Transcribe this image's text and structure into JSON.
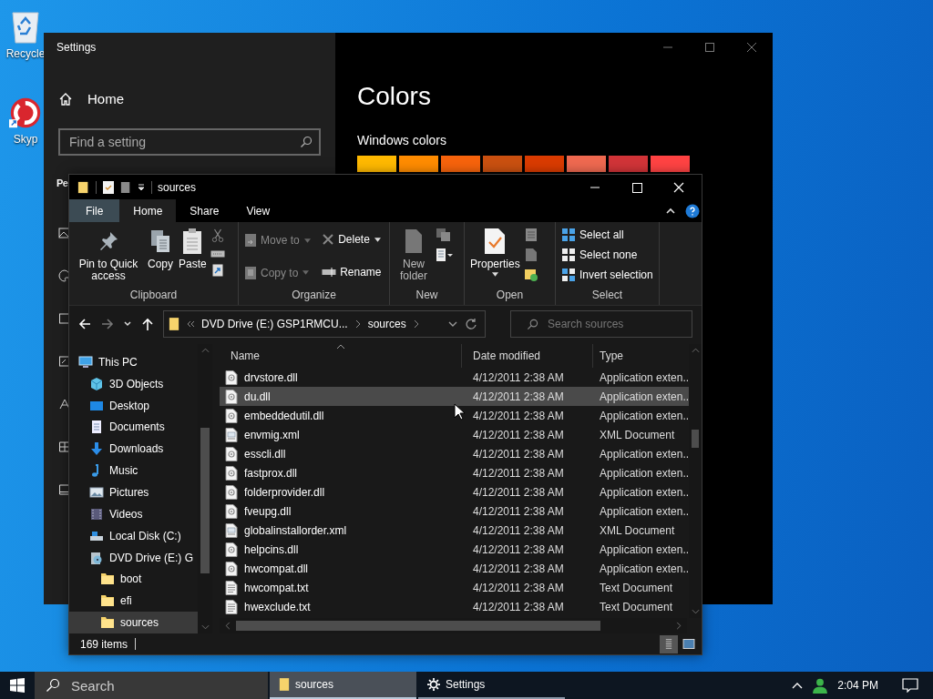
{
  "desktop": {
    "icons": [
      {
        "kind": "recycle",
        "label": "Recycle"
      },
      {
        "kind": "skype",
        "label": "Skyp"
      }
    ]
  },
  "settings": {
    "title": "Settings",
    "home": "Home",
    "search": {
      "placeholder": "Find a setting"
    },
    "section": "Pe",
    "nav_icons": [
      {
        "kind": "picture"
      },
      {
        "kind": "palette"
      },
      {
        "kind": "square"
      },
      {
        "kind": "tablet"
      },
      {
        "kind": "font"
      },
      {
        "kind": "start"
      },
      {
        "kind": "taskbar"
      }
    ],
    "page_title": "Colors",
    "subheading": "Windows colors",
    "swatches": [
      {
        "color": "#ffb900"
      },
      {
        "color": "#ff8c00"
      },
      {
        "color": "#f7630c"
      },
      {
        "color": "#ca5010"
      },
      {
        "color": "#da3b01"
      },
      {
        "color": "#ef6950"
      },
      {
        "color": "#d13438"
      },
      {
        "color": "#ff4343"
      }
    ]
  },
  "explorer": {
    "title": "sources",
    "tabs": [
      {
        "label": "File",
        "kind": "file",
        "selected": false
      },
      {
        "label": "Home",
        "kind": "tab",
        "selected": true
      },
      {
        "label": "Share",
        "kind": "tab",
        "selected": false
      },
      {
        "label": "View",
        "kind": "tab",
        "selected": false
      }
    ],
    "clipboard": {
      "label": "Clipboard",
      "buttons": [
        {
          "label": "Pin to Quick access",
          "kind": "pin"
        },
        {
          "label": "Copy",
          "kind": "copy"
        },
        {
          "label": "Paste",
          "kind": "paste"
        }
      ]
    },
    "organize": {
      "label": "Organize",
      "buttons": [
        {
          "label": "Move to",
          "kind": "move",
          "disabled": true
        },
        {
          "label": "Copy to",
          "kind": "copyto",
          "disabled": true
        },
        {
          "label": "Delete",
          "kind": "delete",
          "disabled": false
        },
        {
          "label": "Rename",
          "kind": "rename",
          "disabled": false
        }
      ]
    },
    "new": {
      "label": "New",
      "button": "New folder"
    },
    "open": {
      "label": "Open",
      "button": "Properties"
    },
    "select": {
      "label": "Select",
      "buttons": [
        {
          "label": "Select all",
          "kind": "all"
        },
        {
          "label": "Select none",
          "kind": "none"
        },
        {
          "label": "Invert selection",
          "kind": "invert"
        }
      ]
    },
    "path": [
      {
        "label": "DVD Drive (E:) GSP1RMCU..."
      },
      {
        "label": "sources"
      }
    ],
    "search": {
      "placeholder": "Search sources"
    },
    "nav": [
      {
        "label": "This PC",
        "kind": "pc",
        "selected": false,
        "children": [
          {
            "label": "3D Objects",
            "kind": "cube",
            "selected": false
          },
          {
            "label": "Desktop",
            "kind": "desktop",
            "selected": false
          },
          {
            "label": "Documents",
            "kind": "documents",
            "selected": false
          },
          {
            "label": "Downloads",
            "kind": "downloads",
            "selected": false
          },
          {
            "label": "Music",
            "kind": "music",
            "selected": false
          },
          {
            "label": "Pictures",
            "kind": "pictures",
            "selected": false
          },
          {
            "label": "Videos",
            "kind": "videos",
            "selected": false
          },
          {
            "label": "Local Disk (C:)",
            "kind": "disk",
            "selected": false
          },
          {
            "label": "DVD Drive (E:) G",
            "kind": "dvd",
            "selected": false,
            "children": [
              {
                "label": "boot",
                "kind": "folder",
                "selected": false
              },
              {
                "label": "efi",
                "kind": "folder",
                "selected": false
              },
              {
                "label": "sources",
                "kind": "folder",
                "selected": true
              }
            ]
          }
        ]
      }
    ],
    "columns": [
      "Name",
      "Date modified",
      "Type"
    ],
    "rows": [
      {
        "name": "drvstore.dll",
        "date": "4/12/2011 2:38 AM",
        "type": "Application exten..",
        "kind": "dll",
        "selected": false
      },
      {
        "name": "du.dll",
        "date": "4/12/2011 2:38 AM",
        "type": "Application exten..",
        "kind": "dll",
        "selected": true
      },
      {
        "name": "embeddedutil.dll",
        "date": "4/12/2011 2:38 AM",
        "type": "Application exten..",
        "kind": "dll",
        "selected": false
      },
      {
        "name": "envmig.xml",
        "date": "4/12/2011 2:38 AM",
        "type": "XML Document",
        "kind": "xml",
        "selected": false
      },
      {
        "name": "esscli.dll",
        "date": "4/12/2011 2:38 AM",
        "type": "Application exten..",
        "kind": "dll",
        "selected": false
      },
      {
        "name": "fastprox.dll",
        "date": "4/12/2011 2:38 AM",
        "type": "Application exten..",
        "kind": "dll",
        "selected": false
      },
      {
        "name": "folderprovider.dll",
        "date": "4/12/2011 2:38 AM",
        "type": "Application exten..",
        "kind": "dll",
        "selected": false
      },
      {
        "name": "fveupg.dll",
        "date": "4/12/2011 2:38 AM",
        "type": "Application exten..",
        "kind": "dll",
        "selected": false
      },
      {
        "name": "globalinstallorder.xml",
        "date": "4/12/2011 2:38 AM",
        "type": "XML Document",
        "kind": "xml",
        "selected": false
      },
      {
        "name": "helpcins.dll",
        "date": "4/12/2011 2:38 AM",
        "type": "Application exten..",
        "kind": "dll",
        "selected": false
      },
      {
        "name": "hwcompat.dll",
        "date": "4/12/2011 2:38 AM",
        "type": "Application exten..",
        "kind": "dll",
        "selected": false
      },
      {
        "name": "hwcompat.txt",
        "date": "4/12/2011 2:38 AM",
        "type": "Text Document",
        "kind": "txt",
        "selected": false
      },
      {
        "name": "hwexclude.txt",
        "date": "4/12/2011 2:38 AM",
        "type": "Text Document",
        "kind": "txt",
        "selected": false
      }
    ],
    "status": {
      "count": "169 items",
      "views": [
        {
          "kind": "details",
          "selected": true
        },
        {
          "kind": "tiles",
          "selected": false
        }
      ]
    }
  },
  "taskbar": {
    "search": {
      "placeholder": "Search"
    },
    "apps": [
      {
        "label": "sources",
        "kind": "folder",
        "selected": true
      },
      {
        "label": "Settings",
        "kind": "gear",
        "selected": false
      }
    ],
    "time": "2:04 PM"
  }
}
